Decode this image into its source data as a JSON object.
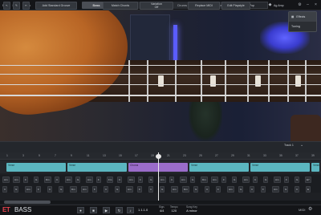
{
  "menu": [
    "File",
    "Edit",
    "Track",
    "Settings",
    "View",
    "Help"
  ],
  "tabs": [
    "Bass",
    "Grooves",
    "Grid Editor",
    "Drums & Keys",
    "Audio Tracker"
  ],
  "active_tab": "Bass",
  "preset": "Chord Pop",
  "amp": "Ag Amp",
  "effects_panel": {
    "items": [
      "Effects",
      "Tuning"
    ]
  },
  "toolbar": {
    "add_groove": "Add Standard Groove",
    "match_chords": "Match Chords",
    "variation_label": "Variation",
    "variation_value": "Off",
    "replace_midi": "Replace MIDI",
    "edit_playstyle": "Edit Playstyle",
    "track_label": "Track 1"
  },
  "ruler": [
    "1",
    "3",
    "5",
    "7",
    "9",
    "11",
    "13",
    "15",
    "17",
    "19",
    "21",
    "23",
    "25",
    "27",
    "29",
    "31",
    "33",
    "35",
    "37",
    "39"
  ],
  "clips": [
    {
      "label": "Verse",
      "color": "teal"
    },
    {
      "label": "Verse",
      "color": "teal"
    },
    {
      "label": "Chorus",
      "color": "purple"
    },
    {
      "label": "Verse",
      "color": "teal"
    },
    {
      "label": "Verse",
      "color": "teal"
    },
    {
      "label": "Verse",
      "color": "teal"
    }
  ],
  "chords_hi": [
    "Am",
    "Am",
    "F",
    "G",
    "Dm",
    "C",
    "Am",
    "G",
    "Am",
    "F",
    "Fm",
    "C",
    "Am",
    "F",
    "G",
    "Am",
    "C",
    "Am",
    "G",
    "Dm",
    "Am",
    "F",
    "G",
    "Am",
    "C",
    "G",
    "Am",
    "F",
    "G",
    "E7"
  ],
  "chords_lo": [
    "C",
    "G",
    "Am",
    "F",
    "C",
    "G",
    "Dm",
    "Am",
    "F",
    "C",
    "G",
    "Am",
    "F",
    "C",
    "G",
    "Am",
    "Dm",
    "G",
    "C",
    "F",
    "Am",
    "G",
    "C",
    "F",
    "Am",
    "G",
    "C",
    "E"
  ],
  "footer": {
    "logo_a": "ET",
    "logo_b": "BASS",
    "position": "1.1.1.0",
    "sign_label": "Sign.",
    "sign_value": "4/4",
    "tempo_label": "Tempo",
    "tempo_value": "120",
    "songkey_label": "Song Key",
    "songkey_value": "A minor",
    "midi_label": "MIDI"
  },
  "colors": {
    "accent": "#e4434d",
    "teal": "#5bb6c0",
    "purple": "#9a6cc9",
    "neon": "#5a5cff"
  }
}
